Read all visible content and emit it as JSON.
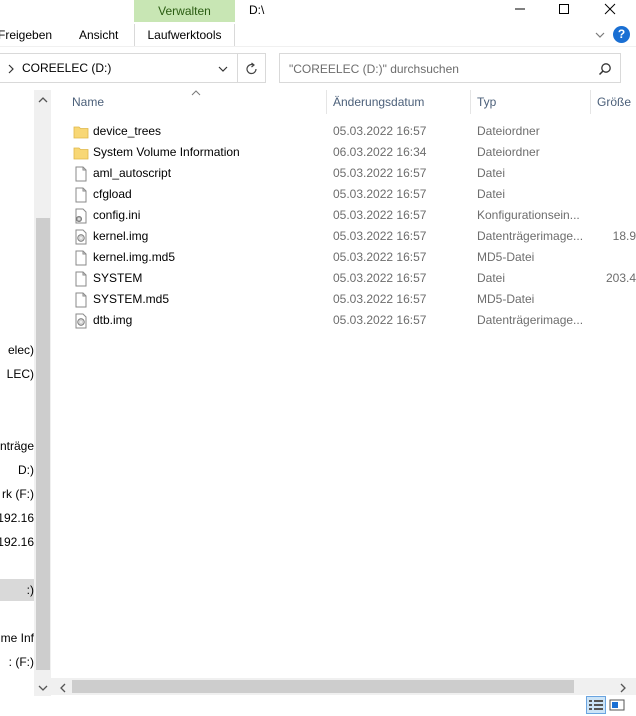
{
  "window": {
    "title": "D:\\",
    "contextual_tab_group": "Verwalten"
  },
  "ribbon": {
    "tabs": [
      {
        "label": "Freigeben"
      },
      {
        "label": "Ansicht"
      },
      {
        "label": "Laufwerktools"
      }
    ],
    "help_label": "?"
  },
  "address": {
    "path": "COREELEC (D:)",
    "search_placeholder": "\"COREELEC (D:)\" durchsuchen"
  },
  "nav": {
    "items": [
      {
        "label": "elec)"
      },
      {
        "label": "LEC)"
      },
      {
        "label": "enträge"
      },
      {
        "label": "D:)"
      },
      {
        "label": "rk (F:)"
      },
      {
        "label": "192.16"
      },
      {
        "label": "192.16"
      },
      {
        "label": ":)"
      },
      {
        "label": "me Inf"
      },
      {
        "label": ": (F:)"
      }
    ]
  },
  "columns": {
    "name": "Name",
    "date": "Änderungsdatum",
    "type": "Typ",
    "size": "Größe"
  },
  "files": [
    {
      "name": "device_trees",
      "date": "05.03.2022 16:57",
      "type": "Dateiordner",
      "size": "",
      "icon": "folder-icon"
    },
    {
      "name": "System Volume Information",
      "date": "06.03.2022 16:34",
      "type": "Dateiordner",
      "size": "",
      "icon": "folder-icon"
    },
    {
      "name": "aml_autoscript",
      "date": "05.03.2022 16:57",
      "type": "Datei",
      "size": "",
      "icon": "file-icon"
    },
    {
      "name": "cfgload",
      "date": "05.03.2022 16:57",
      "type": "Datei",
      "size": "",
      "icon": "file-icon"
    },
    {
      "name": "config.ini",
      "date": "05.03.2022 16:57",
      "type": "Konfigurationsein...",
      "size": "",
      "icon": "config-file-icon"
    },
    {
      "name": "kernel.img",
      "date": "05.03.2022 16:57",
      "type": "Datenträgerimage...",
      "size": "18.9",
      "icon": "disk-image-icon"
    },
    {
      "name": "kernel.img.md5",
      "date": "05.03.2022 16:57",
      "type": "MD5-Datei",
      "size": "",
      "icon": "file-icon"
    },
    {
      "name": "SYSTEM",
      "date": "05.03.2022 16:57",
      "type": "Datei",
      "size": "203.4",
      "icon": "file-icon"
    },
    {
      "name": "SYSTEM.md5",
      "date": "05.03.2022 16:57",
      "type": "MD5-Datei",
      "size": "",
      "icon": "file-icon"
    },
    {
      "name": "dtb.img",
      "date": "05.03.2022 16:57",
      "type": "Datenträgerimage...",
      "size": "",
      "icon": "disk-image-icon"
    }
  ],
  "colors": {
    "contextual_tab_bg": "#c8e6b4",
    "selection_gray": "#d9d9d9",
    "header_text": "#4c607a",
    "folder_yellow": "#f8d775",
    "help_blue": "#1a6fd3"
  }
}
